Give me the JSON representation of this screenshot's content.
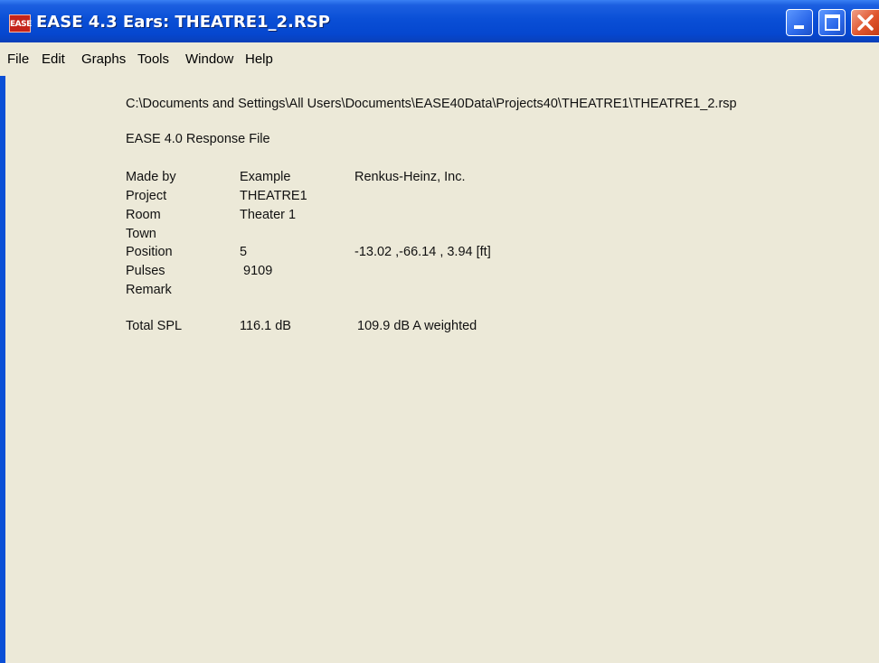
{
  "window": {
    "app_icon_text": "EASE",
    "title": "EASE 4.3  Ears: THEATRE1_2.RSP",
    "controls": [
      "minimize-icon",
      "maximize-icon",
      "close-icon"
    ],
    "colors": {
      "titlebar": "#0a4fd6",
      "client_background": "#ece9d8",
      "close_button": "#e0562e"
    }
  },
  "menu": {
    "items": [
      {
        "label": "File"
      },
      {
        "label": "Edit"
      },
      {
        "label": "Graphs"
      },
      {
        "label": "Tools"
      },
      {
        "label": "Window"
      },
      {
        "label": "Help"
      }
    ]
  },
  "file_info": {
    "path": "C:\\Documents and Settings\\All Users\\Documents\\EASE40Data\\Projects40\\THEATRE1\\THEATRE1_2.rsp",
    "file_type": "EASE 4.0 Response File",
    "fields": [
      {
        "label": "Made by",
        "value": "Example",
        "extra": "Renkus-Heinz, Inc."
      },
      {
        "label": "Project",
        "value": "THEATRE1",
        "extra": ""
      },
      {
        "label": "Room",
        "value": "Theater 1",
        "extra": ""
      },
      {
        "label": "Town",
        "value": "",
        "extra": ""
      },
      {
        "label": "Position",
        "value": "5",
        "extra": "-13.02 ,-66.14 , 3.94  [ft]"
      },
      {
        "label": "Pulses",
        "value": " 9109",
        "extra": ""
      },
      {
        "label": "Remark",
        "value": "",
        "extra": ""
      }
    ],
    "total_spl": {
      "label": "Total SPL",
      "value": "116.1 dB",
      "weighted": "109.9 dB A weighted"
    }
  }
}
